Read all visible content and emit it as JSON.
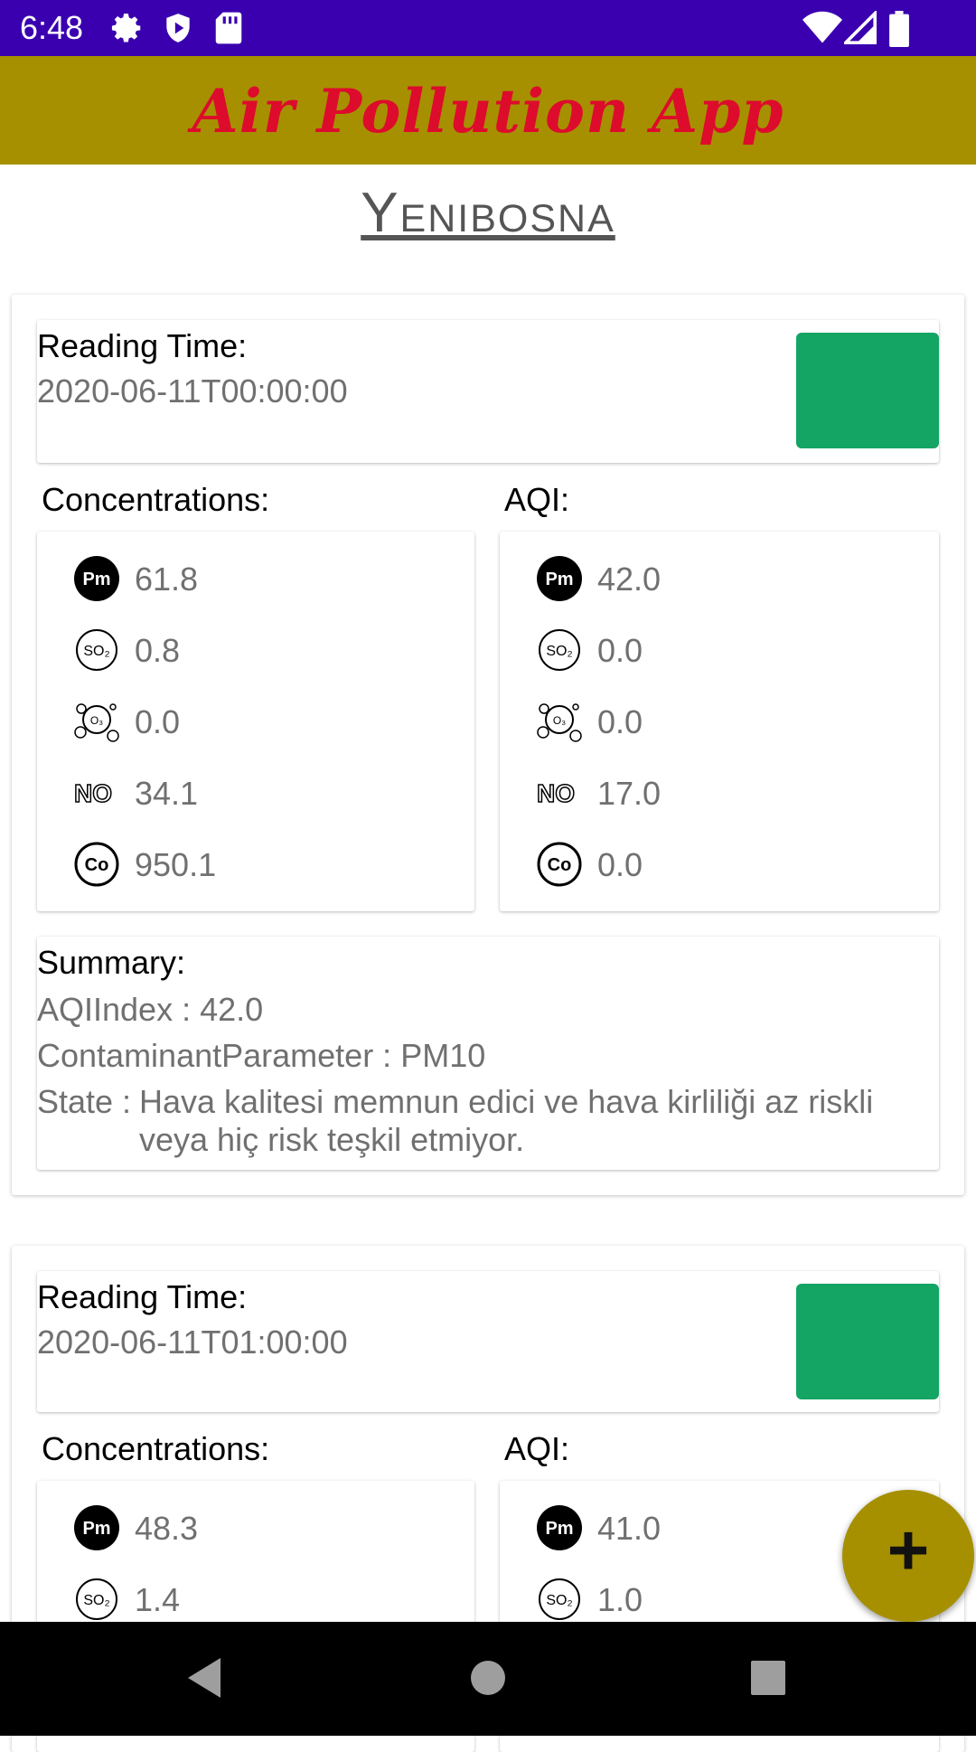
{
  "status_bar": {
    "time": "6:48",
    "icons": [
      "gear-icon",
      "shield-icon",
      "sd-card-icon",
      "wifi-icon",
      "signal-icon",
      "battery-icon"
    ]
  },
  "app_bar": {
    "title": "Air Pollution App"
  },
  "city": "Yenibosna",
  "labels": {
    "reading_time": "Reading Time:",
    "concentrations": "Concentrations:",
    "aqi": "AQI:",
    "summary": "Summary:"
  },
  "colors": {
    "status_good": "#14a463",
    "accent": "#a69000",
    "title_red": "#dd0b2c"
  },
  "readings": [
    {
      "reading_time": "2020-06-11T00:00:00",
      "concentrations": {
        "pm": "61.8",
        "so2": "0.8",
        "o3": "0.0",
        "no": "34.1",
        "co": "950.1"
      },
      "aqi": {
        "pm": "42.0",
        "so2": "0.0",
        "o3": "0.0",
        "no": "17.0",
        "co": "0.0"
      },
      "summary": {
        "aqi_index": "AQIIndex : 42.0",
        "contaminant": "ContaminantParameter : PM10",
        "state_prefix": "State : ",
        "state_line1": "Hava kalitesi memnun edici ve hava kirliliği az riskli",
        "state_line2": "veya hiç risk teşkil etmiyor."
      }
    },
    {
      "reading_time": "2020-06-11T01:00:00",
      "concentrations": {
        "pm": "48.3",
        "so2": "1.4"
      },
      "aqi": {
        "pm": "41.0",
        "so2": "1.0"
      }
    }
  ],
  "fab": {
    "label": "+"
  }
}
